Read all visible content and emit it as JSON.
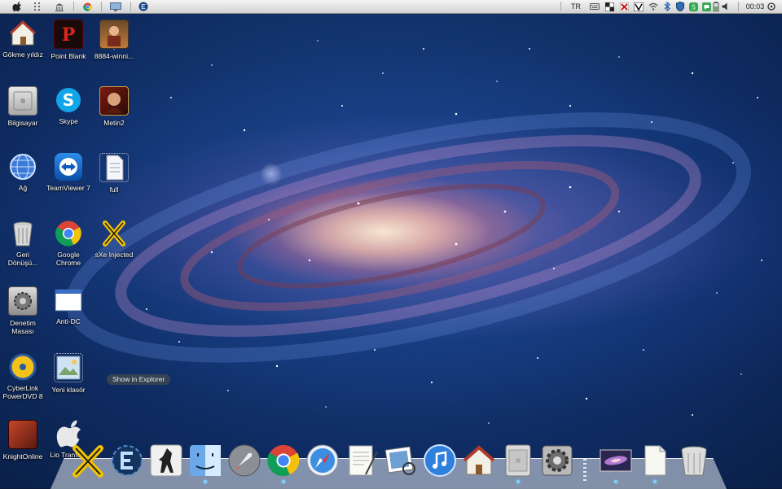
{
  "menubar": {
    "language": "TR",
    "clock": "00:03",
    "left_items": [
      "apple-icon",
      "grid-icon",
      "bank-icon",
      "chrome-icon",
      "screen-icon",
      "cheat-engine-icon"
    ],
    "tray_items": [
      "keyboard-icon",
      "tray-checker-icon",
      "tray-flag-icon",
      "tray-xv-icon",
      "tray-shield-icon",
      "wifi-icon",
      "bluetooth-icon",
      "tray-green-icon",
      "tray-chat-icon",
      "tray-battery-icon",
      "volume-icon"
    ]
  },
  "desktop": {
    "icons": [
      {
        "id": "gokme-yildiz",
        "label": "Gökme yıldız",
        "icon": "home-folder-icon"
      },
      {
        "id": "point-blank",
        "label": "Point Blank",
        "icon": "point-blank-icon"
      },
      {
        "id": "8884-winning",
        "label": "8884-winni...",
        "icon": "photo-icon"
      },
      {
        "id": "bilgisayar",
        "label": "Bilgisayar",
        "icon": "computer-icon"
      },
      {
        "id": "skype",
        "label": "Skype",
        "icon": "skype-icon"
      },
      {
        "id": "metin2",
        "label": "Metin2",
        "icon": "metin2-icon"
      },
      {
        "id": "ag",
        "label": "Ağ",
        "icon": "network-globe-icon"
      },
      {
        "id": "teamviewer",
        "label": "TeamViewer 7",
        "icon": "teamviewer-icon"
      },
      {
        "id": "full",
        "label": "full",
        "icon": "document-icon"
      },
      {
        "id": "geri-donusum",
        "label": "Geri Dönüşü...",
        "icon": "trash-icon"
      },
      {
        "id": "google-chrome",
        "label": "Google Chrome",
        "icon": "chrome-icon"
      },
      {
        "id": "sxe-injected",
        "label": "sXe Injected",
        "icon": "sxe-icon"
      },
      {
        "id": "denetim-masasi",
        "label": "Denetim Masası",
        "icon": "control-panel-icon"
      },
      {
        "id": "anti-dc",
        "label": "Anti-DC",
        "icon": "window-icon"
      },
      {
        "id": "cyberlink",
        "label": "CyberLink PowerDVD 8",
        "icon": "powerdvd-icon"
      },
      {
        "id": "yeni-klasor",
        "label": "Yeni klasör",
        "icon": "folder-icon"
      },
      {
        "id": "knightonline",
        "label": "KnightOnline",
        "icon": "knight-online-icon"
      },
      {
        "id": "lion-transformation",
        "label": "Lio Tranfo...",
        "icon": "apple-icon"
      }
    ],
    "tooltip": "Show in Explorer"
  },
  "dock": {
    "items": [
      {
        "id": "sxe",
        "icon": "sxe-icon",
        "running": false
      },
      {
        "id": "cheat-engine",
        "icon": "cheat-engine-icon",
        "running": false
      },
      {
        "id": "counter-strike",
        "icon": "counter-strike-icon",
        "running": false
      },
      {
        "id": "finder",
        "icon": "finder-icon",
        "running": true
      },
      {
        "id": "launchpad",
        "icon": "rocket-icon",
        "running": false
      },
      {
        "id": "chrome",
        "icon": "chrome-icon",
        "running": true
      },
      {
        "id": "safari",
        "icon": "safari-compass-icon",
        "running": false
      },
      {
        "id": "textedit",
        "icon": "text-edit-icon",
        "running": false
      },
      {
        "id": "preview",
        "icon": "preview-photos-icon",
        "running": false
      },
      {
        "id": "itunes",
        "icon": "itunes-icon",
        "running": false
      },
      {
        "id": "home",
        "icon": "home-icon",
        "running": false
      },
      {
        "id": "computer",
        "icon": "mac-pro-icon",
        "running": true
      },
      {
        "id": "system-preferences",
        "icon": "system-preferences-icon",
        "running": false
      },
      {
        "id": "desktop-stack",
        "icon": "desktop-wallpaper-icon",
        "running": true
      },
      {
        "id": "documents",
        "icon": "documents-stack-icon",
        "running": true
      },
      {
        "id": "trash",
        "icon": "trash-icon",
        "running": false
      }
    ]
  },
  "colors": {
    "menubar_top": "#f4f4f4",
    "menubar_bottom": "#d2d2d2",
    "dock_indicator": "#7fd3ff",
    "desktop_label": "#ffffff"
  }
}
